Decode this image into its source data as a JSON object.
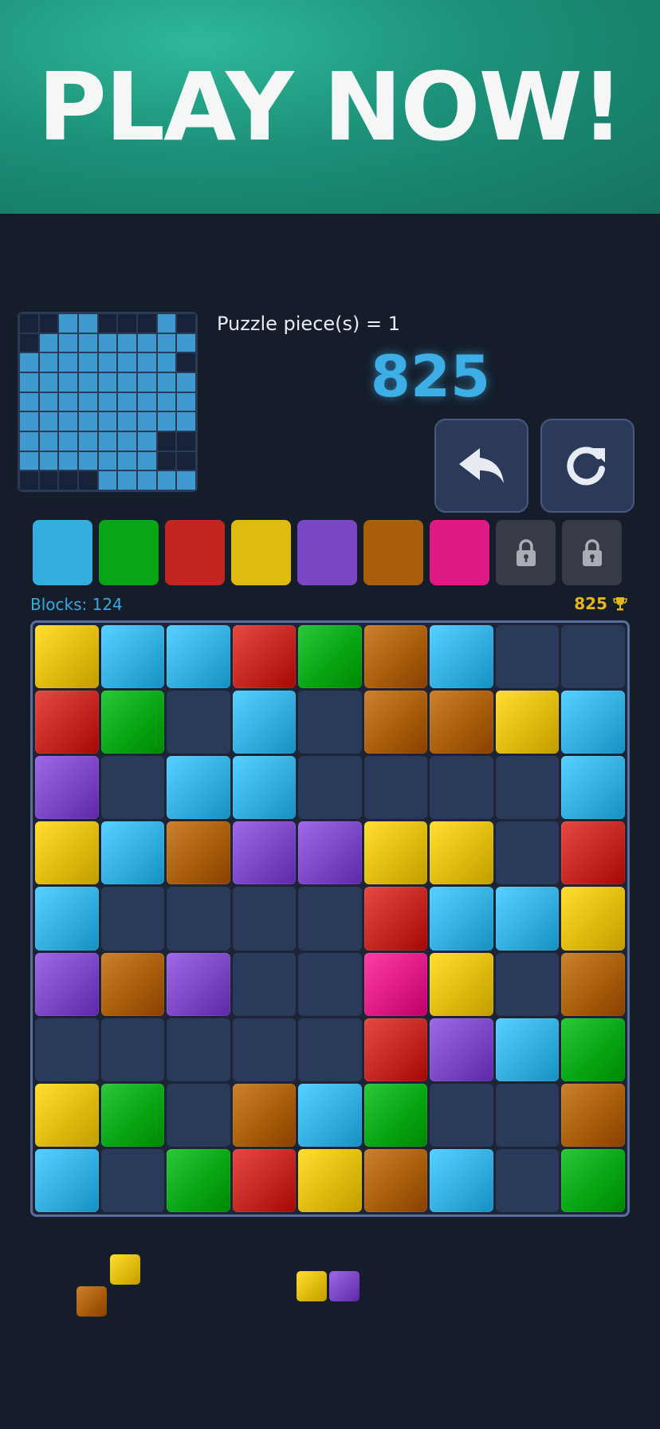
{
  "banner": {
    "title": "PLAY NOW!"
  },
  "colors": {
    "blue": "#33aee0",
    "green": "#08a614",
    "red": "#c32620",
    "yellow": "#dfbb0f",
    "purple": "#7b46c6",
    "orange": "#a85e0a",
    "pink": "#dd1a86"
  },
  "minimap": {
    "rows": [
      "001100010",
      "011111111",
      "111111110",
      "111111111",
      "111111111",
      "111111111",
      "111111100",
      "111111100",
      "000011111"
    ]
  },
  "info": {
    "pieces_label": "Puzzle piece(s) = 1",
    "score": "825"
  },
  "controls": {
    "undo_icon": "undo-arrow-icon",
    "restart_icon": "restart-icon"
  },
  "palette": [
    {
      "color": "blue",
      "locked": false
    },
    {
      "color": "green",
      "locked": false
    },
    {
      "color": "red",
      "locked": false
    },
    {
      "color": "yellow",
      "locked": false
    },
    {
      "color": "purple",
      "locked": false
    },
    {
      "color": "orange",
      "locked": false
    },
    {
      "color": "pink",
      "locked": false
    },
    {
      "color": "",
      "locked": true,
      "icon": "lock-icon"
    },
    {
      "color": "",
      "locked": true,
      "icon": "lock-icon"
    }
  ],
  "status": {
    "blocks_label": "Blocks: 124",
    "best_score": "825",
    "best_icon": "trophy-icon"
  },
  "board": {
    "grid": [
      [
        "yellow",
        "blue",
        "blue",
        "red",
        "green",
        "orange",
        "blue",
        "",
        ""
      ],
      [
        "red",
        "green",
        "",
        "blue",
        "",
        "orange",
        "orange",
        "yellow",
        "blue"
      ],
      [
        "purple",
        "",
        "blue",
        "blue",
        "",
        "",
        "",
        "",
        "blue"
      ],
      [
        "yellow",
        "blue",
        "orange",
        "purple",
        "purple",
        "yellow",
        "yellow",
        "",
        "red"
      ],
      [
        "blue",
        "",
        "",
        "",
        "",
        "red",
        "blue",
        "blue",
        "yellow"
      ],
      [
        "purple",
        "orange",
        "purple",
        "",
        "",
        "pink",
        "yellow",
        "",
        "orange"
      ],
      [
        "",
        "",
        "",
        "",
        "",
        "red",
        "purple",
        "blue",
        "green"
      ],
      [
        "yellow",
        "green",
        "",
        "orange",
        "blue",
        "green",
        "",
        "",
        "orange"
      ],
      [
        "blue",
        "",
        "green",
        "red",
        "yellow",
        "orange",
        "blue",
        "",
        "green"
      ]
    ]
  },
  "tray": [
    {
      "color": "yellow"
    },
    {
      "color": "orange"
    },
    {
      "color": "yellow"
    },
    {
      "color": "purple"
    }
  ]
}
